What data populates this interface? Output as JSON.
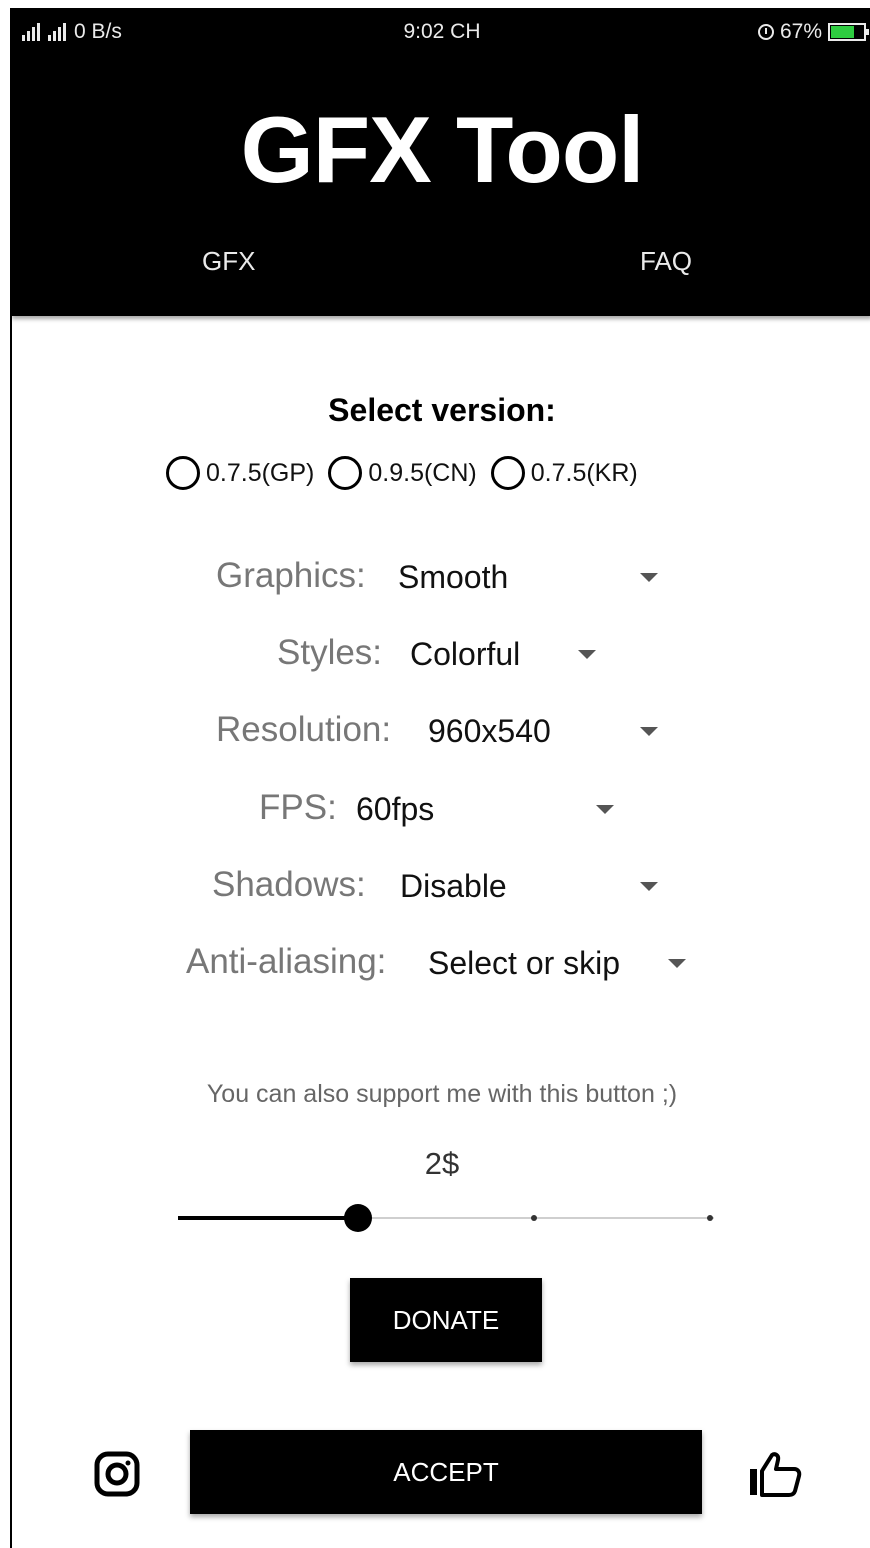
{
  "status_bar": {
    "network": "0 B/s",
    "time": "9:02 CH",
    "battery": "67%"
  },
  "header": {
    "title": "GFX Tool",
    "tabs": [
      {
        "label": "GFX"
      },
      {
        "label": "FAQ"
      }
    ]
  },
  "version": {
    "heading": "Select version:",
    "options": [
      {
        "label": "0.7.5(GP)",
        "selected": false
      },
      {
        "label": "0.9.5(CN)",
        "selected": false
      },
      {
        "label": "0.7.5(KR)",
        "selected": false
      }
    ]
  },
  "settings": {
    "graphics": {
      "label": "Graphics:",
      "value": "Smooth"
    },
    "styles": {
      "label": "Styles:",
      "value": "Colorful"
    },
    "resolution": {
      "label": "Resolution:",
      "value": "960x540"
    },
    "fps": {
      "label": "FPS:",
      "value": "60fps"
    },
    "shadows": {
      "label": "Shadows:",
      "value": "Disable"
    },
    "anti_aliasing": {
      "label": "Anti-aliasing:",
      "value": "Select or skip"
    }
  },
  "donate": {
    "support_text": "You can also support me with this button ;)",
    "amount": "2$",
    "slider_steps": 4,
    "slider_position": 1,
    "button_label": "DONATE"
  },
  "footer": {
    "accept_label": "ACCEPT",
    "left_icon": "instagram-icon",
    "right_icon": "like-icon"
  },
  "colors": {
    "header_bg": "#000000",
    "label_gray": "#777777",
    "battery_green": "#2ecc40"
  }
}
